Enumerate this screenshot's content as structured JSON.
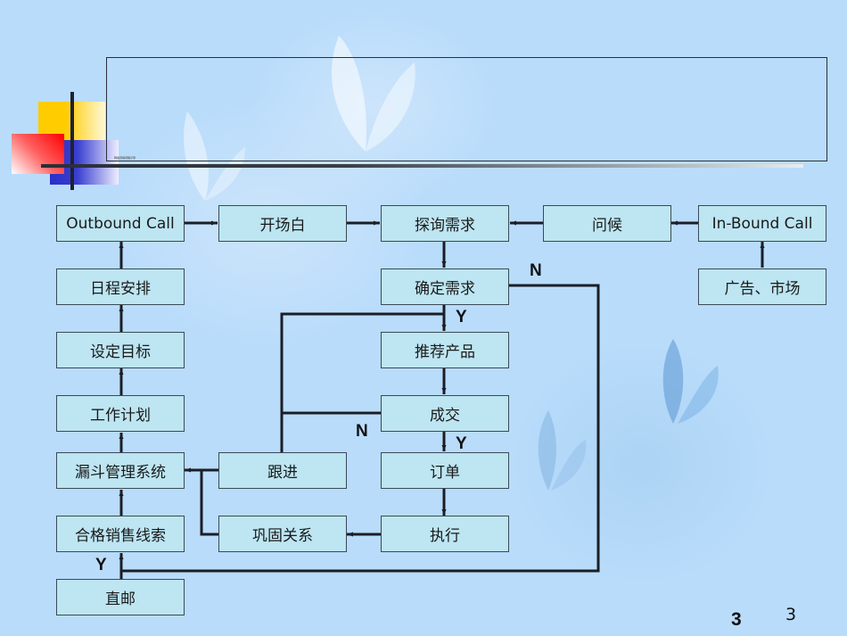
{
  "slide": {
    "title": "",
    "subtitle_tiny": "网络营销流程示意",
    "page_number_bold": "3",
    "page_number": "3"
  },
  "colors": {
    "background": "#b9dcfb",
    "node_fill": "#bde5f2",
    "node_border": "#3a4a55",
    "line": "#1b1e26",
    "deco_yellow": "#ffcc00",
    "deco_blue": "#2a2fc8",
    "deco_red": "#ff0000"
  },
  "diagram": {
    "nodes": {
      "outbound": "Outbound Call",
      "opening": "开场白",
      "probe": "探询需求",
      "greet": "问候",
      "inbound": "In-Bound Call",
      "schedule": "日程安排",
      "confirm": "确定需求",
      "ads": "广告、市场",
      "goals": "设定目标",
      "recommend": "推荐产品",
      "plan": "工作计划",
      "deal": "成交",
      "funnel": "漏斗管理系统",
      "followup": "跟进",
      "order": "订单",
      "leads": "合格销售线索",
      "consolidate": "巩固关系",
      "execute": "执行",
      "mail": "直邮"
    },
    "labels": {
      "confirm_no": "N",
      "confirm_yes": "Y",
      "deal_no": "N",
      "deal_yes": "Y",
      "mail_yes": "Y"
    },
    "edges": [
      {
        "from": "outbound",
        "to": "opening"
      },
      {
        "from": "opening",
        "to": "probe"
      },
      {
        "from": "greet",
        "to": "probe"
      },
      {
        "from": "inbound",
        "to": "greet"
      },
      {
        "from": "ads",
        "to": "inbound"
      },
      {
        "from": "probe",
        "to": "confirm"
      },
      {
        "from": "confirm",
        "to": "recommend",
        "label": "Y"
      },
      {
        "from": "confirm",
        "to": "leads",
        "label": "N"
      },
      {
        "from": "recommend",
        "to": "deal"
      },
      {
        "from": "deal",
        "to": "order",
        "label": "Y"
      },
      {
        "from": "deal",
        "to": "followup",
        "label": "N"
      },
      {
        "from": "followup",
        "to": "confirm"
      },
      {
        "from": "followup",
        "to": "funnel"
      },
      {
        "from": "consolidate",
        "to": "funnel"
      },
      {
        "from": "order",
        "to": "execute"
      },
      {
        "from": "execute",
        "to": "consolidate"
      },
      {
        "from": "mail",
        "to": "leads",
        "label": "Y"
      },
      {
        "from": "leads",
        "to": "funnel"
      },
      {
        "from": "funnel",
        "to": "plan"
      },
      {
        "from": "plan",
        "to": "goals"
      },
      {
        "from": "goals",
        "to": "schedule"
      },
      {
        "from": "schedule",
        "to": "outbound"
      }
    ]
  }
}
